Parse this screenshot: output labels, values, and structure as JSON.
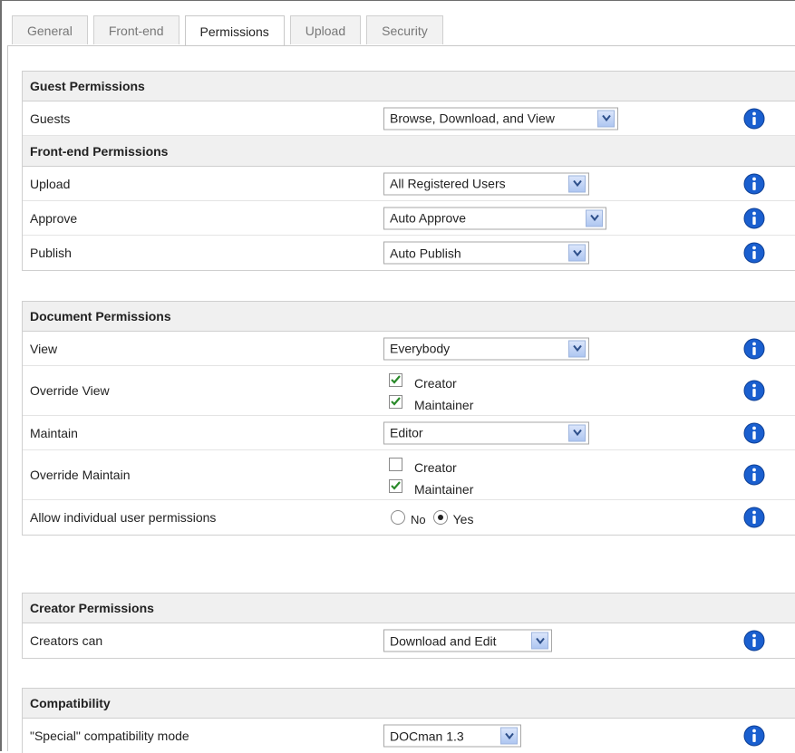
{
  "tabs": [
    {
      "label": "General",
      "active": false
    },
    {
      "label": "Front-end",
      "active": false
    },
    {
      "label": "Permissions",
      "active": true
    },
    {
      "label": "Upload",
      "active": false
    },
    {
      "label": "Security",
      "active": false
    }
  ],
  "guest": {
    "title": "Guest Permissions",
    "guests_label": "Guests",
    "guests_value": "Browse, Download, and View"
  },
  "frontend": {
    "title": "Front-end Permissions",
    "upload_label": "Upload",
    "upload_value": "All Registered Users",
    "approve_label": "Approve",
    "approve_value": "Auto Approve",
    "publish_label": "Publish",
    "publish_value": "Auto Publish"
  },
  "document": {
    "title": "Document Permissions",
    "view_label": "View",
    "view_value": "Everybody",
    "override_view_label": "Override View",
    "override_view": [
      {
        "label": "Creator",
        "checked": true
      },
      {
        "label": "Maintainer",
        "checked": true
      }
    ],
    "maintain_label": "Maintain",
    "maintain_value": "Editor",
    "override_maintain_label": "Override Maintain",
    "override_maintain": [
      {
        "label": "Creator",
        "checked": false
      },
      {
        "label": "Maintainer",
        "checked": true
      }
    ],
    "individual_label": "Allow individual user permissions",
    "individual_options": [
      "No",
      "Yes"
    ],
    "individual_selected": "Yes"
  },
  "creator": {
    "title": "Creator Permissions",
    "creators_label": "Creators can",
    "creators_value": "Download and Edit"
  },
  "compat": {
    "title": "Compatibility",
    "mode_label": "\"Special\" compatibility mode",
    "mode_value": "DOCman 1.3"
  },
  "colors": {
    "info_icon": "#1a5fcf",
    "header_bg": "#f0f0f0",
    "check_mark": "#2a8a2a"
  },
  "icons": [
    "info-icon",
    "dropdown-arrow-icon",
    "checkmark-icon"
  ]
}
